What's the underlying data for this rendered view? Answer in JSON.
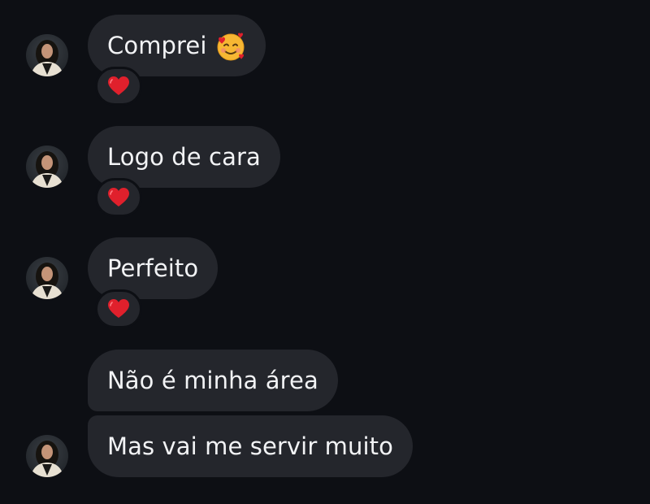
{
  "messages": [
    {
      "text": "Comprei",
      "emoji": "smiling-face-with-hearts-icon",
      "reaction": "red-heart-icon"
    },
    {
      "text": "Logo de cara",
      "reaction": "red-heart-icon"
    },
    {
      "text": "Perfeito",
      "reaction": "red-heart-icon"
    },
    {
      "text": "Não é minha área"
    },
    {
      "text": "Mas vai me servir muito"
    }
  ],
  "colors": {
    "background": "#0d0f14",
    "bubble": "#24262c",
    "text": "#f2f3f5",
    "heart": "#e0202c"
  }
}
